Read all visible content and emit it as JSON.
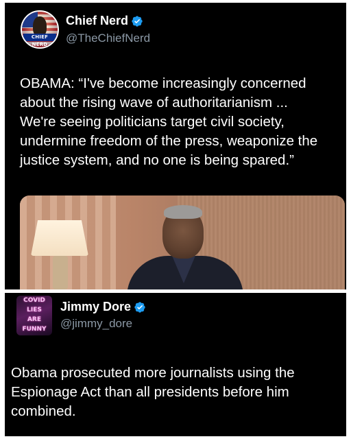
{
  "posts": [
    {
      "display_name": "Chief Nerd",
      "handle": "@TheChiefNerd",
      "avatar_text": "CHIEF NERD",
      "verified": true,
      "text": "OBAMA: “I've become increasingly concerned\nabout the rising wave of authoritarianism ...\nWe're seeing politicians target civil society,\nundermine freedom of the press, weaponize the\njustice system, and no one is being spared.”",
      "has_media": true
    },
    {
      "display_name": "Jimmy Dore",
      "handle": "@jimmy_dore",
      "avatar_text": [
        "COVID",
        "LIES",
        "ARE",
        "FUNNY"
      ],
      "verified": true,
      "text": "Obama prosecuted more journalists using the\nEspionage Act than all presidents before him\ncombined."
    }
  ],
  "colors": {
    "background": "#000000",
    "text": "#ffffff",
    "handle": "#8b98a5",
    "verified_badge": "#1d9bf0"
  },
  "icons": {
    "verified": "verified-badge-icon"
  }
}
